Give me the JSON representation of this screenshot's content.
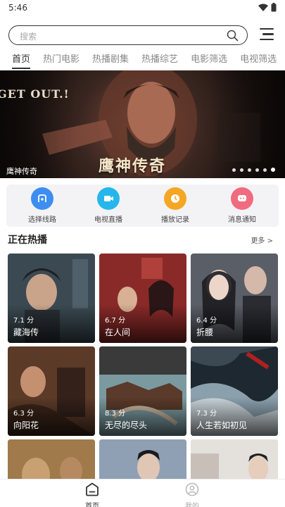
{
  "status_bar": {
    "time": "5:46"
  },
  "search": {
    "placeholder": "搜索"
  },
  "tabs": [
    {
      "label": "首页"
    },
    {
      "label": "热门电影"
    },
    {
      "label": "热播剧集"
    },
    {
      "label": "热播综艺"
    },
    {
      "label": "电影筛选"
    },
    {
      "label": "电视筛选"
    }
  ],
  "banner": {
    "headline": "GET OUT.!",
    "logo_text": "鹰神传奇",
    "caption": "鹰神传奇",
    "slide_count": 6,
    "active_slide": 6
  },
  "quick_actions": [
    {
      "label": "选择线路",
      "icon": "route-icon",
      "color": "#3d8ef0"
    },
    {
      "label": "电视直播",
      "icon": "tv-live-icon",
      "color": "#25b6ec"
    },
    {
      "label": "播放记录",
      "icon": "history-icon",
      "color": "#f5a623"
    },
    {
      "label": "消息通知",
      "icon": "message-icon",
      "color": "#f06b7f"
    }
  ],
  "section": {
    "title": "正在热播",
    "more": "更多 >"
  },
  "cards": [
    {
      "score": "7.1 分",
      "title": "藏海传",
      "color": "#3b4a52"
    },
    {
      "score": "6.7 分",
      "title": "在人间",
      "color": "#8a2a28"
    },
    {
      "score": "6.4 分",
      "title": "折腰",
      "color": "#5a5e66"
    },
    {
      "score": "6.3 分",
      "title": "向阳花",
      "color": "#5c3a28"
    },
    {
      "score": "8.3 分",
      "title": "无尽的尽头",
      "color": "#4e6a72"
    },
    {
      "score": "7.3 分",
      "title": "人生若如初见",
      "color": "#3c4852"
    },
    {
      "score": "",
      "title": "",
      "color": "#8a6238"
    },
    {
      "score": "",
      "title": "",
      "color": "#6e7a8a"
    },
    {
      "score": "",
      "title": "",
      "color": "#b8b0a8"
    }
  ],
  "bottom_nav": [
    {
      "label": "首页",
      "icon": "home-icon"
    },
    {
      "label": "我的",
      "icon": "profile-icon"
    }
  ]
}
